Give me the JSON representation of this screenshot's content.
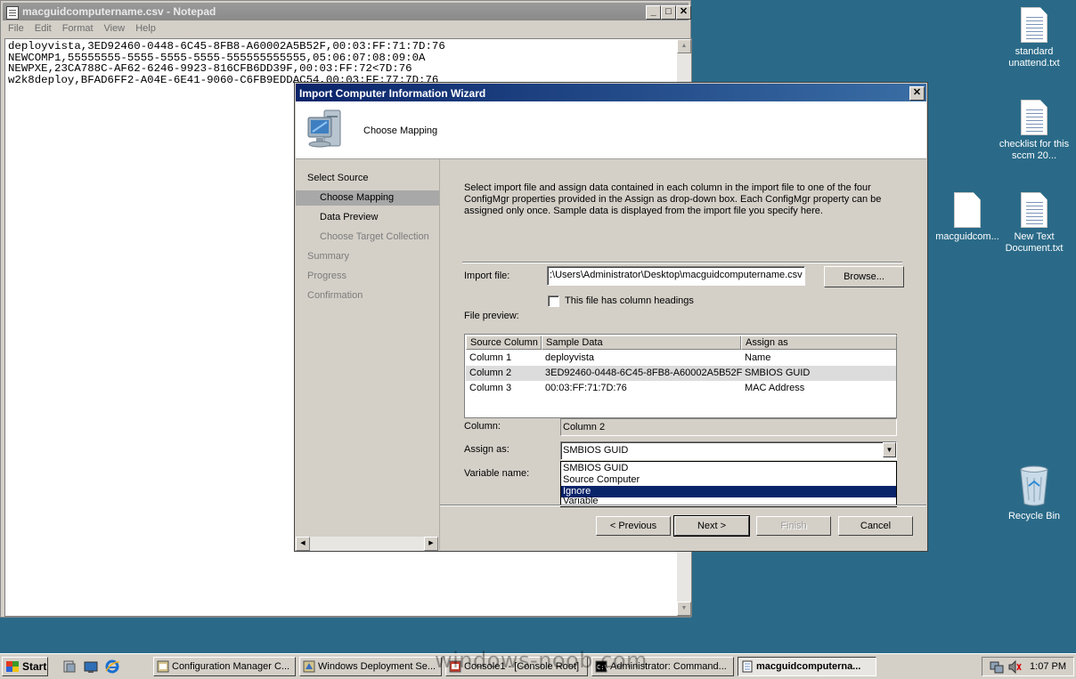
{
  "notepad": {
    "title": "macguidcomputername.csv - Notepad",
    "menu": [
      "File",
      "Edit",
      "Format",
      "View",
      "Help"
    ],
    "lines": [
      "deployvista,3ED92460-0448-6C45-8FB8-A60002A5B52F,00:03:FF:71:7D:76",
      "NEWCOMP1,55555555-5555-5555-5555-555555555555,05:06:07:08:09:0A",
      "NEWPXE,23CA788C-AF62-6246-9923-816CFB6DD39F,00:03:FF:72<7D:76",
      "w2k8deploy,BFAD6FF2-A04E-6E41-9060-C6FB9EDDAC54,00:03:FF:77:7D:76"
    ]
  },
  "wizard": {
    "title": "Import Computer Information Wizard",
    "header": "Choose Mapping",
    "nav": [
      {
        "label": "Select Source",
        "state": "normal"
      },
      {
        "label": "Choose Mapping",
        "state": "selected"
      },
      {
        "label": "Data Preview",
        "state": "normal"
      },
      {
        "label": "Choose Target Collection",
        "state": "disabled"
      },
      {
        "label": "Summary",
        "state": "disabled"
      },
      {
        "label": "Progress",
        "state": "disabled"
      },
      {
        "label": "Confirmation",
        "state": "disabled"
      }
    ],
    "description": "Select import file and assign data contained in each column in the import file to one of the four ConfigMgr properties provided in the Assign as drop-down box. Each ConfigMgr property can be assigned only once. Sample data is displayed from the import file you specify here.",
    "import_file_label": "Import file:",
    "import_file_value": ":\\Users\\Administrator\\Desktop\\macguidcomputername.csv",
    "browse_label": "Browse...",
    "column_headings_label": "This file has column headings",
    "file_preview_label": "File preview:",
    "table": {
      "headers": [
        "Source Column",
        "Sample Data",
        "Assign as"
      ],
      "rows": [
        [
          "Column 1",
          "deployvista",
          "Name"
        ],
        [
          "Column 2",
          "3ED92460-0448-6C45-8FB8-A60002A5B52F",
          "SMBIOS GUID"
        ],
        [
          "Column 3",
          "00:03:FF:71:7D:76",
          "MAC Address"
        ]
      ]
    },
    "column_label": "Column:",
    "column_value": "Column 2",
    "assign_label": "Assign as:",
    "assign_value": "SMBIOS GUID",
    "assign_options": [
      "SMBIOS GUID",
      "Source Computer",
      "Ignore",
      "Variable"
    ],
    "assign_highlighted": "Ignore",
    "variable_label": "Variable name:",
    "buttons": {
      "previous": "< Previous",
      "next": "Next >",
      "finish": "Finish",
      "cancel": "Cancel"
    }
  },
  "desktop": {
    "icons": [
      {
        "label": "standard unattend.txt"
      },
      {
        "label": "checklist for this sccm 20..."
      },
      {
        "label": "macguidcom..."
      },
      {
        "label": "New Text Document.txt"
      },
      {
        "label": "Recycle Bin"
      }
    ]
  },
  "taskbar": {
    "start": "Start",
    "tasks": [
      "Configuration Manager C...",
      "Windows Deployment Se...",
      "Console1 - [Console Root]",
      "Administrator: Command...",
      "macguidcomputerna..."
    ],
    "clock": "1:07 PM",
    "watermark": "windows-noob.com"
  }
}
